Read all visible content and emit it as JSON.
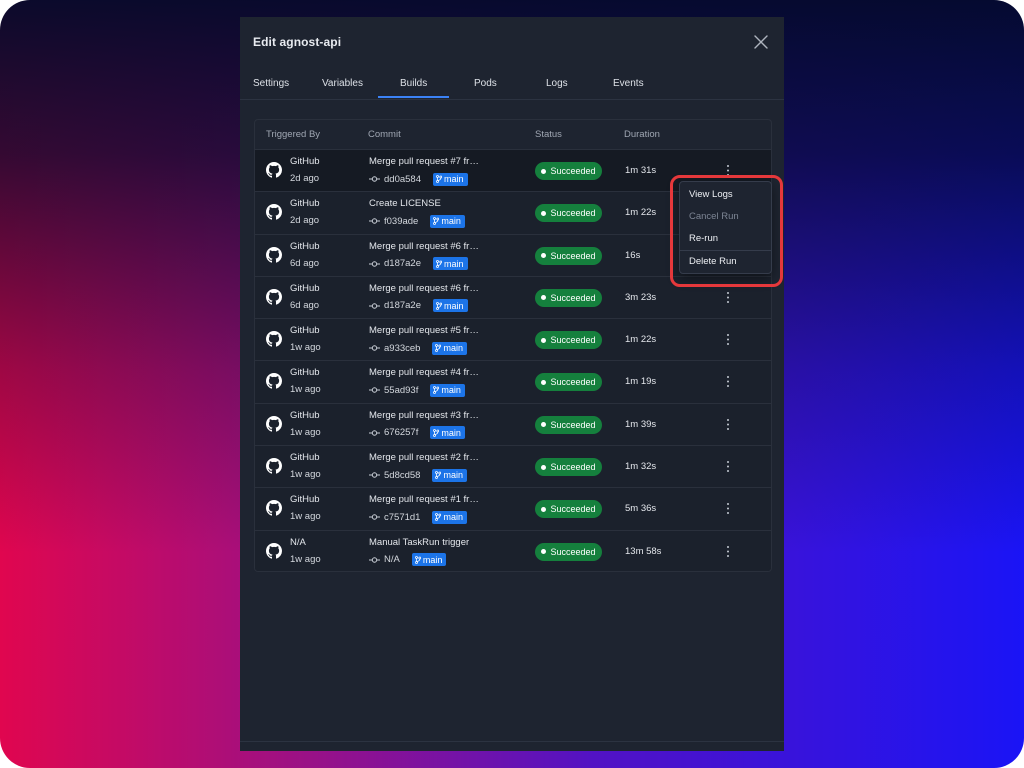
{
  "window": {
    "title": "Edit agnost-api",
    "close_icon": "close-icon"
  },
  "tabs": [
    {
      "label": "Settings"
    },
    {
      "label": "Variables"
    },
    {
      "label": "Builds",
      "active": true
    },
    {
      "label": "Pods"
    },
    {
      "label": "Logs"
    },
    {
      "label": "Events"
    }
  ],
  "table": {
    "columns": {
      "triggered_by": "Triggered By",
      "commit": "Commit",
      "status": "Status",
      "duration": "Duration"
    },
    "icons": {
      "trigger": "github-icon",
      "commit": "commit-icon",
      "branch": "branch-icon",
      "row_menu": "kebab-icon"
    },
    "rows": [
      {
        "source": "GitHub",
        "time": "2d ago",
        "message": "Merge pull request #7 fr…",
        "hash": "dd0a584",
        "branch": "main",
        "status": "Succeeded",
        "duration": "1m 31s"
      },
      {
        "source": "GitHub",
        "time": "2d ago",
        "message": "Create LICENSE",
        "hash": "f039ade",
        "branch": "main",
        "status": "Succeeded",
        "duration": "1m 22s"
      },
      {
        "source": "GitHub",
        "time": "6d ago",
        "message": "Merge pull request #6 fr…",
        "hash": "d187a2e",
        "branch": "main",
        "status": "Succeeded",
        "duration": "16s"
      },
      {
        "source": "GitHub",
        "time": "6d ago",
        "message": "Merge pull request #6 fr…",
        "hash": "d187a2e",
        "branch": "main",
        "status": "Succeeded",
        "duration": "3m 23s"
      },
      {
        "source": "GitHub",
        "time": "1w ago",
        "message": "Merge pull request #5 fr…",
        "hash": "a933ceb",
        "branch": "main",
        "status": "Succeeded",
        "duration": "1m 22s"
      },
      {
        "source": "GitHub",
        "time": "1w ago",
        "message": "Merge pull request #4 fr…",
        "hash": "55ad93f",
        "branch": "main",
        "status": "Succeeded",
        "duration": "1m 19s"
      },
      {
        "source": "GitHub",
        "time": "1w ago",
        "message": "Merge pull request #3 fr…",
        "hash": "676257f",
        "branch": "main",
        "status": "Succeeded",
        "duration": "1m 39s"
      },
      {
        "source": "GitHub",
        "time": "1w ago",
        "message": "Merge pull request #2 fr…",
        "hash": "5d8cd58",
        "branch": "main",
        "status": "Succeeded",
        "duration": "1m 32s"
      },
      {
        "source": "GitHub",
        "time": "1w ago",
        "message": "Merge pull request #1 fr…",
        "hash": "c7571d1",
        "branch": "main",
        "status": "Succeeded",
        "duration": "5m 36s"
      },
      {
        "source": "N/A",
        "time": "1w ago",
        "message": "Manual TaskRun trigger",
        "hash": "N/A",
        "branch": "main",
        "status": "Succeeded",
        "duration": "13m 58s"
      }
    ]
  },
  "context_menu": {
    "items": [
      {
        "label": "View Logs"
      },
      {
        "label": "Cancel Run",
        "disabled": true
      },
      {
        "label": "Re-run"
      },
      {
        "label": "Delete Run"
      }
    ]
  },
  "colors": {
    "panel_bg": "#1e2430",
    "accent": "#3b82f6",
    "success": "#15803d",
    "branch": "#1c74e8",
    "highlight": "#e5383b"
  }
}
